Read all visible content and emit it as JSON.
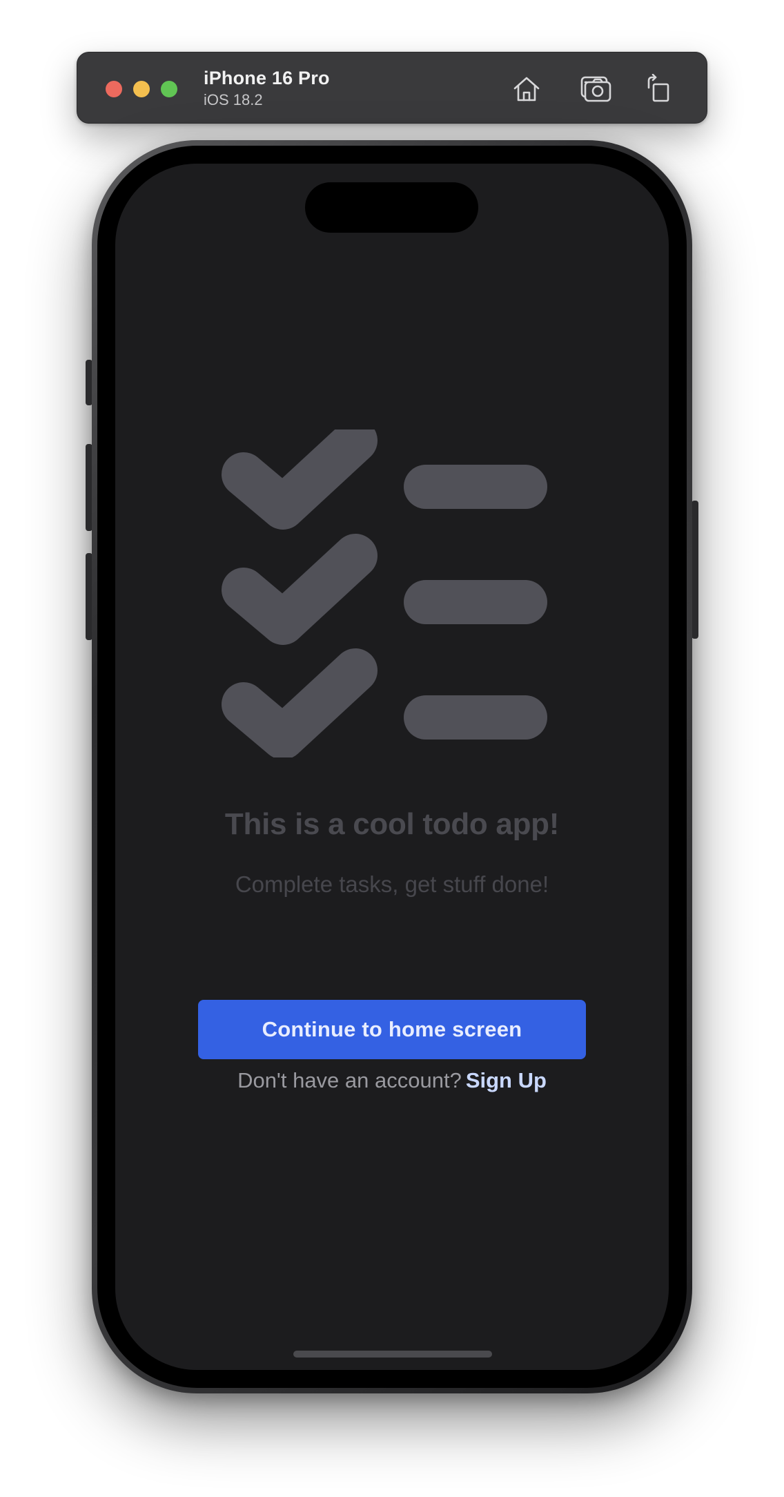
{
  "simulator": {
    "device_name": "iPhone 16 Pro",
    "os_version": "iOS 18.2",
    "toolbar": {
      "home_icon": "home-icon",
      "screenshot_icon": "camera-icon",
      "rotate_icon": "rotate-icon"
    },
    "traffic_lights": [
      "close",
      "minimize",
      "zoom"
    ]
  },
  "app": {
    "illustration_icon": "checklist-icon",
    "checklist_rows": 3,
    "title": "This is a cool todo app!",
    "subtitle": "Complete tasks, get stuff done!",
    "primary_button_label": "Continue to home screen",
    "signup_prompt": "Don't have an account?",
    "signup_link": "Sign Up"
  },
  "colors": {
    "screen_background": "#1c1c1e",
    "illustration": "#515158",
    "primary_button": "#3461e3",
    "signup_link": "#c9d8ff"
  }
}
